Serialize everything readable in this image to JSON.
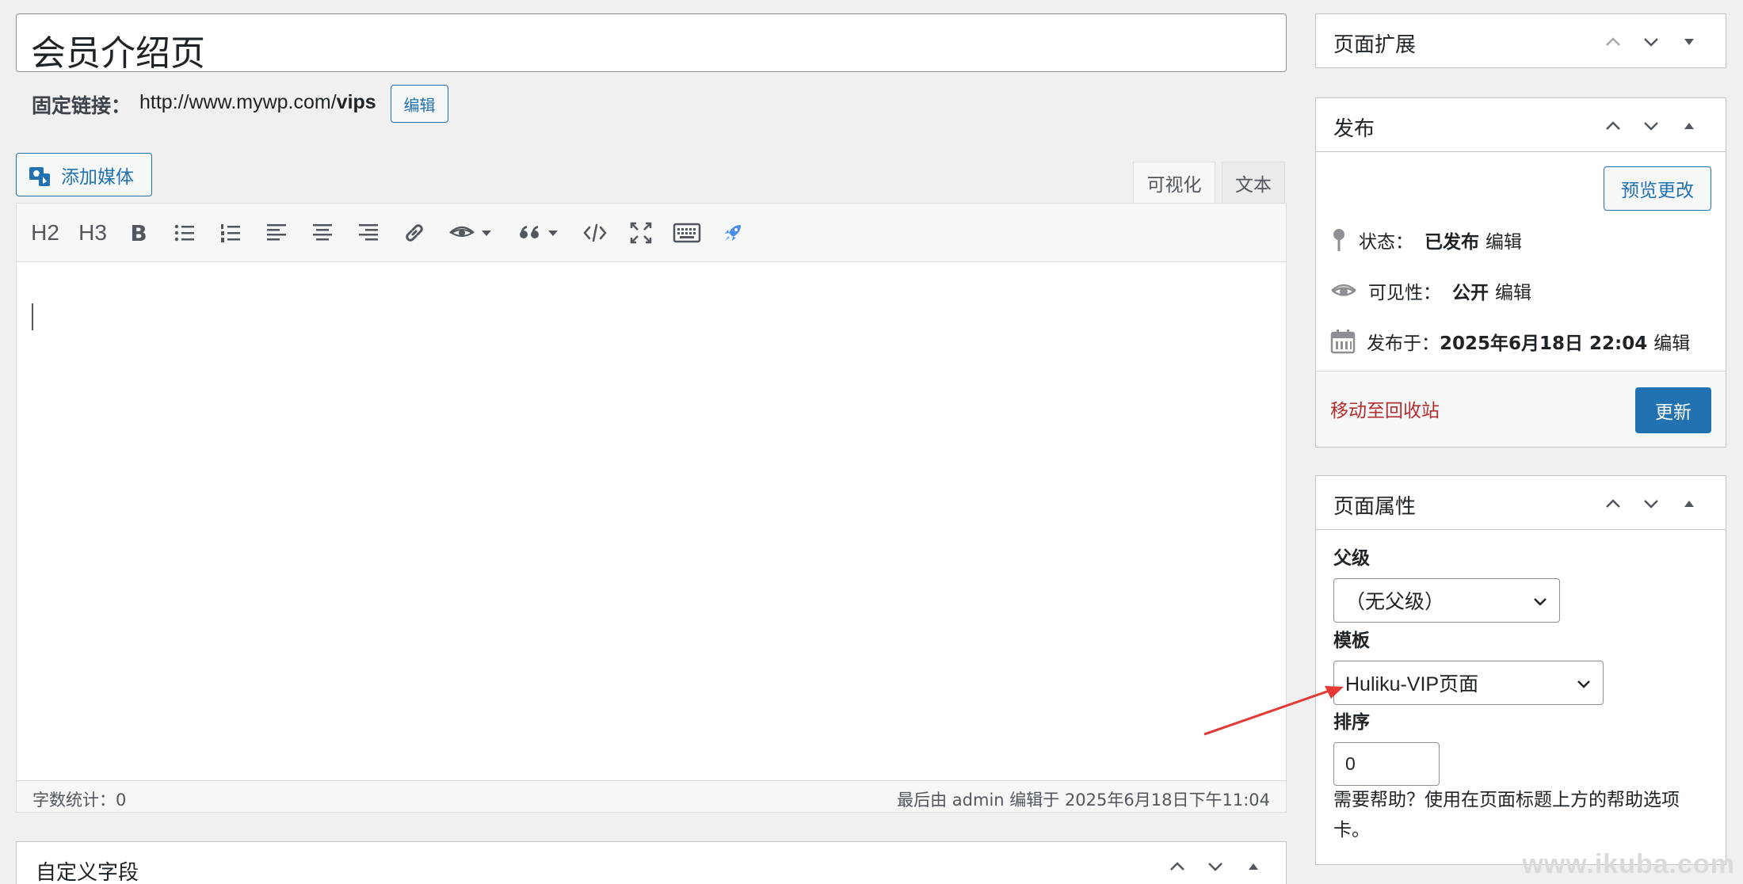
{
  "title": {
    "value": "会员介绍页"
  },
  "permalink": {
    "label": "固定链接：",
    "url_prefix": "http://www.mywp.com/",
    "slug": "vips",
    "edit_label": "编辑"
  },
  "media": {
    "add_label": "添加媒体"
  },
  "editor_tabs": {
    "visual": "可视化",
    "text": "文本"
  },
  "toolbar": {
    "h2": "H2",
    "h3": "H3",
    "bold": "B"
  },
  "status_bar": {
    "word_count": "字数统计：0",
    "last_edit": "最后由 admin 编辑于 2025年6月18日下午11:04"
  },
  "custom_fields": {
    "title": "自定义字段"
  },
  "sidebar": {
    "page_ext": {
      "title": "页面扩展"
    },
    "publish": {
      "title": "发布",
      "preview_label": "预览更改",
      "status_label": "状态：",
      "status_value": "已发布",
      "visibility_label": "可见性：",
      "visibility_value": "公开",
      "published_label": "发布于：",
      "published_value": "2025年6月18日 22:04",
      "edit_label": "编辑",
      "trash_label": "移动至回收站",
      "update_label": "更新"
    },
    "attributes": {
      "title": "页面属性",
      "parent_label": "父级",
      "parent_value": "（无父级）",
      "template_label": "模板",
      "template_value": "Huliku-VIP页面",
      "order_label": "排序",
      "order_value": "0",
      "help_text": "需要帮助？使用在页面标题上方的帮助选项卡。"
    }
  },
  "watermark": "www.ikuba.com",
  "colors": {
    "accent": "#2271b1",
    "danger": "#b32d2e",
    "annotation_arrow": "#e53935"
  }
}
